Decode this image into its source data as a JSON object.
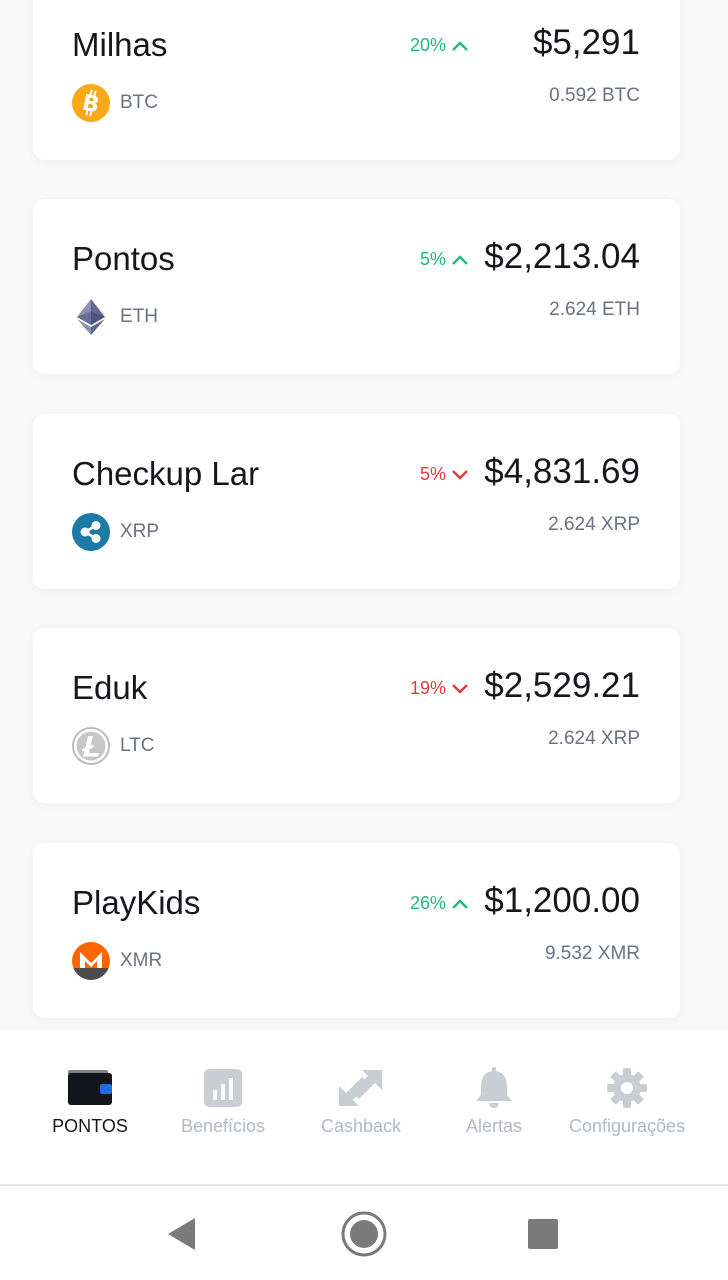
{
  "assets": [
    {
      "name": "Milhas",
      "ticker": "BTC",
      "icon": "bitcoin-icon",
      "change": "20%",
      "direction": "up",
      "amount": "$5,291",
      "holding": "0.592 BTC"
    },
    {
      "name": "Pontos",
      "ticker": "ETH",
      "icon": "ethereum-icon",
      "change": "5%",
      "direction": "up",
      "amount": "$2,213.04",
      "holding": "2.624 ETH"
    },
    {
      "name": "Checkup Lar",
      "ticker": "XRP",
      "icon": "ripple-icon",
      "change": "5%",
      "direction": "down",
      "amount": "$4,831.69",
      "holding": "2.624 XRP"
    },
    {
      "name": "Eduk",
      "ticker": "LTC",
      "icon": "litecoin-icon",
      "change": "19%",
      "direction": "down",
      "amount": "$2,529.21",
      "holding": "2.624 XRP"
    },
    {
      "name": "PlayKids",
      "ticker": "XMR",
      "icon": "monero-icon",
      "change": "26%",
      "direction": "up",
      "amount": "$1,200.00",
      "holding": "9.532 XMR"
    }
  ],
  "tabs": [
    {
      "label": "PONTOS",
      "icon": "wallet-icon",
      "active": true
    },
    {
      "label": "Benefícios",
      "icon": "bar-chart-icon",
      "active": false
    },
    {
      "label": "Cashback",
      "icon": "exchange-arrows-icon",
      "active": false
    },
    {
      "label": "Alertas",
      "icon": "bell-icon",
      "active": false
    },
    {
      "label": "Configurações",
      "icon": "gear-icon",
      "active": false
    }
  ],
  "colors": {
    "up": "#1fb97a",
    "down": "#de3b3b",
    "muted": "#6b7280",
    "tab_inactive": "#b3b8c1",
    "text": "#15171c"
  }
}
